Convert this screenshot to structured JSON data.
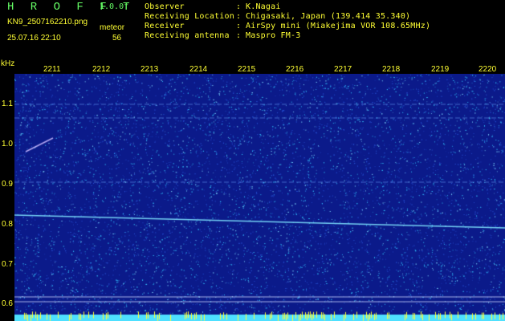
{
  "header": {
    "app_title": "H R O F F T",
    "version": "1.0.0f",
    "filename": "KN9_2507162210.png",
    "mode": "meteor",
    "datetime": "25.07.16 22:10",
    "count": "56",
    "info": [
      {
        "label": "Observer",
        "value": "K.Nagai"
      },
      {
        "label": "Receiving Location",
        "value": "Chigasaki, Japan (139.414 35.340)"
      },
      {
        "label": "Receiver",
        "value": "AirSpy mini (Miakejima VOR 108.65MHz)"
      },
      {
        "label": "Receiving antenna",
        "value": "Maspro FM-3"
      }
    ],
    "separator": ":"
  },
  "axis": {
    "unit": "kHz",
    "x_ticks": [
      "2211",
      "2212",
      "2213",
      "2214",
      "2215",
      "2216",
      "2217",
      "2218",
      "2219",
      "2220"
    ],
    "y_ticks": [
      "1.1",
      "1.0",
      "0.9",
      "0.8",
      "0.7",
      "0.6"
    ]
  },
  "colors": {
    "background": "#000000",
    "label_yellow": "#ffff33",
    "title_green": "#66ff66",
    "spectrogram_bg": "#0b1a8a",
    "noise_cyan": "#35c6ff",
    "signal_cyan": "#7fe6ff",
    "baseline_cyan": "#4ee0ff"
  }
}
